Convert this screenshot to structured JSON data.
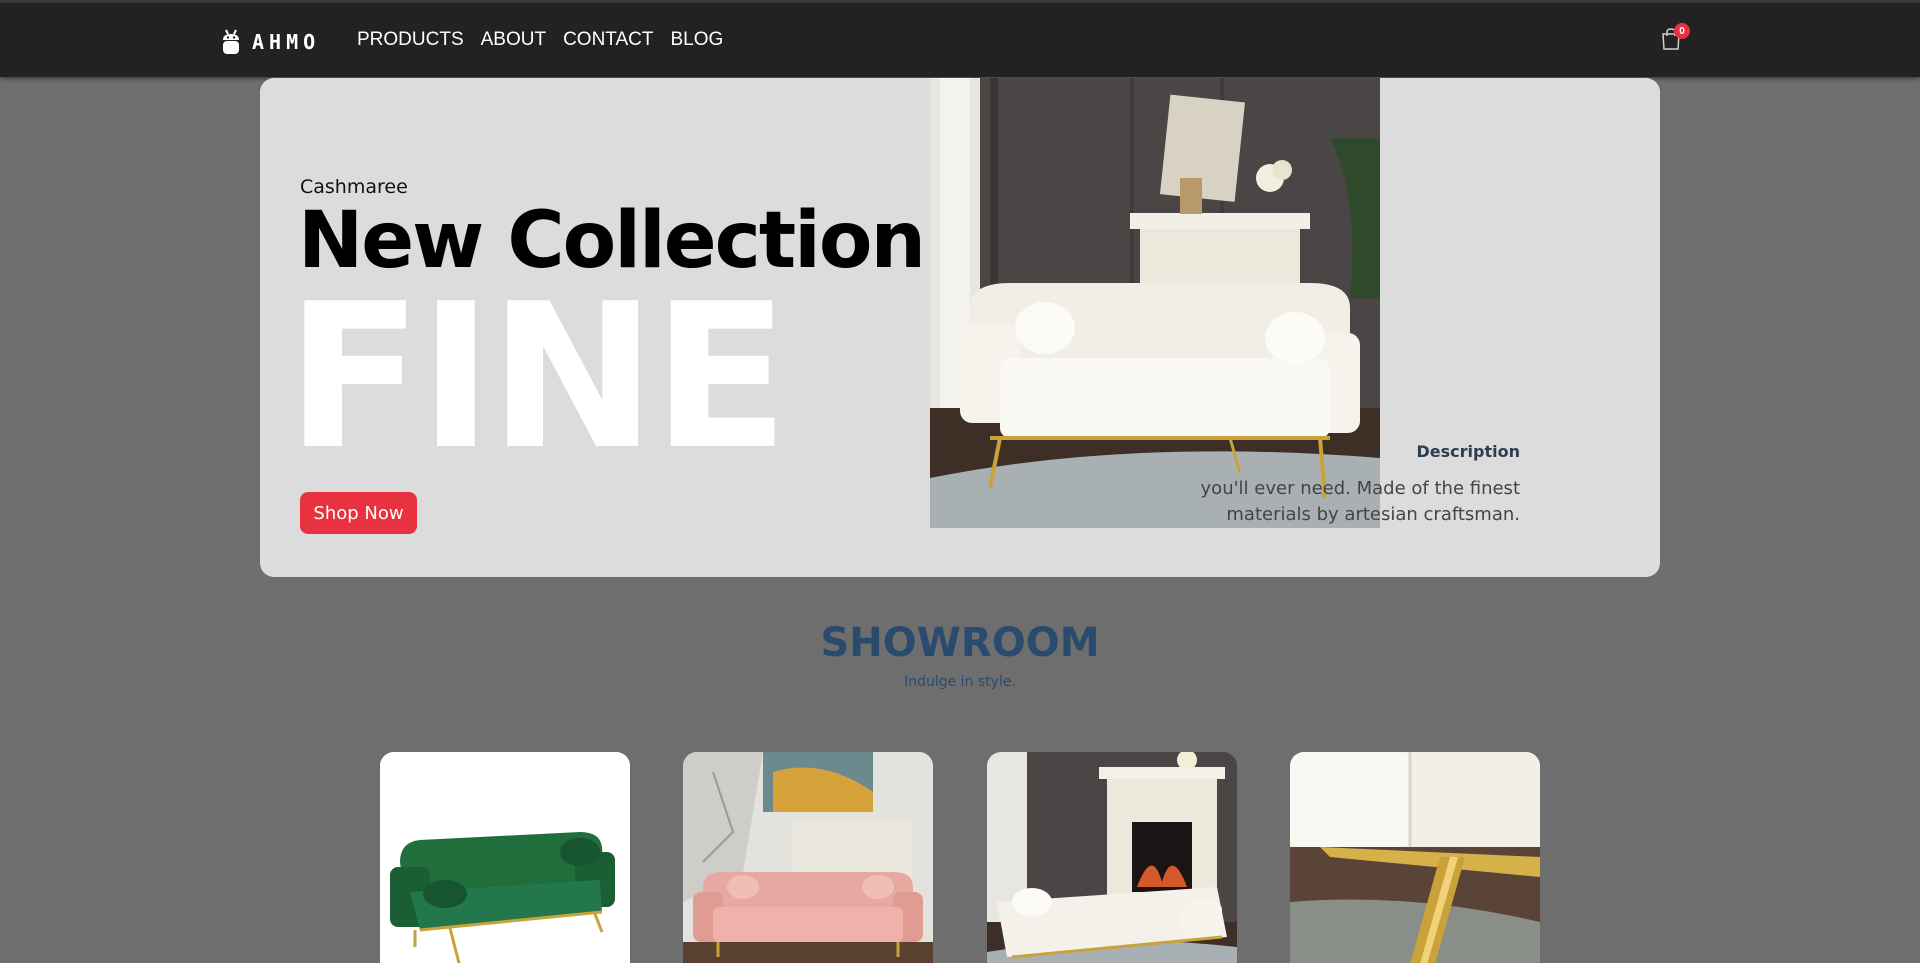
{
  "nav": {
    "brand": "AHMO",
    "links": [
      "PRODUCTS",
      "ABOUT",
      "CONTACT",
      "BLOG"
    ],
    "cart_count": "0"
  },
  "hero": {
    "brand": "Cashmaree",
    "title": "New Collection",
    "big_word": "FINE",
    "button": "Shop Now",
    "description_title": "Description",
    "description_text": "you'll ever need. Made of the finest materials by artesian craftsman."
  },
  "showroom": {
    "title": "SHOWROOM",
    "subtitle": "Indulge in style."
  },
  "colors": {
    "accent": "#e8323f",
    "nav_bg": "#222222",
    "hero_bg": "#dcdcdc",
    "heading": "#2a4a6e"
  },
  "products": [
    {
      "icon": "green-sofa-image"
    },
    {
      "icon": "pink-sofa-image"
    },
    {
      "icon": "white-sofa-fireplace-image"
    },
    {
      "icon": "sofa-leg-closeup-image"
    }
  ]
}
